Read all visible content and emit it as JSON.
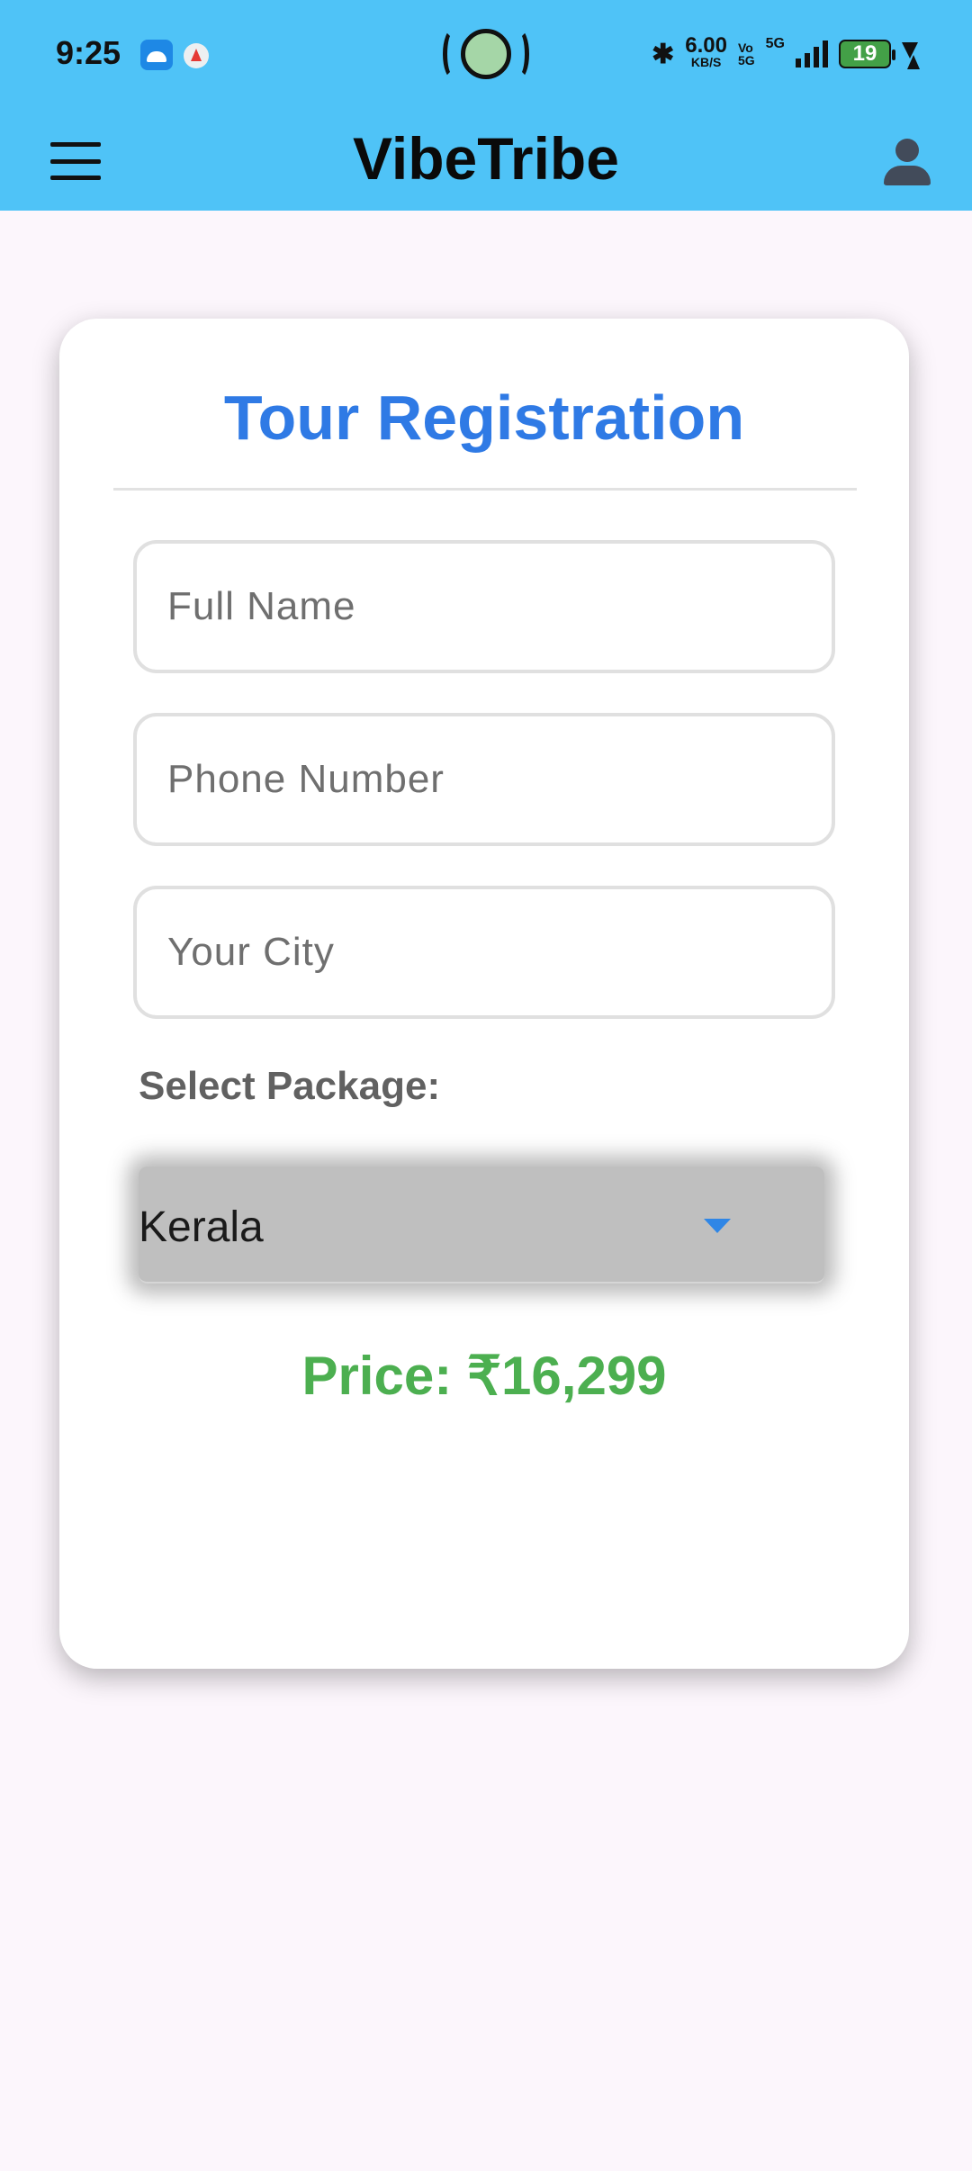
{
  "status_bar": {
    "time": "9:25",
    "net_speed": "6.00",
    "net_unit": "KB/S",
    "volte_top": "Vo",
    "volte_bottom": "5G",
    "network": "5G",
    "battery": "19"
  },
  "app_bar": {
    "title": "VibeTribe",
    "menu_icon": "hamburger-menu-icon",
    "profile_icon": "person-icon"
  },
  "form": {
    "title": "Tour Registration",
    "full_name": {
      "placeholder": "Full Name",
      "value": ""
    },
    "phone": {
      "placeholder": "Phone Number",
      "value": ""
    },
    "city": {
      "placeholder": "Your City",
      "value": ""
    },
    "package_label": "Select Package:",
    "package_selected": "Kerala",
    "price": "Price: ₹16,299"
  },
  "colors": {
    "app_bar": "#4fc3f7",
    "title_blue": "#2f7ae5",
    "price_green": "#4caf50",
    "background": "#fcf6fc"
  }
}
